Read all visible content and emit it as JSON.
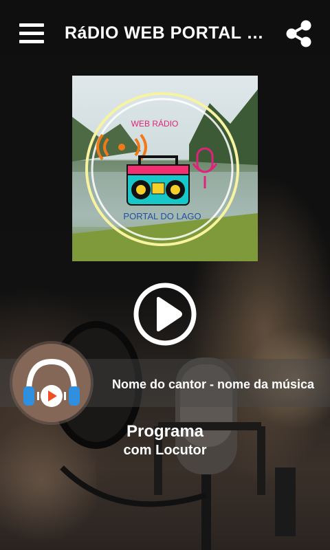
{
  "app": {
    "title": "RáDIO WEB PORTAL DO LAGO"
  },
  "icons": {
    "menu": "menu-icon",
    "share": "share-icon",
    "play": "play-icon",
    "headphones": "headphones-icon"
  },
  "album_art": {
    "line1": "WEB RÁDIO",
    "line2": "PORTAL DO LAGO"
  },
  "now_playing": {
    "track": "Nome do cantor - nome da música"
  },
  "program": {
    "name": "Programa",
    "host": "com Locutor"
  },
  "colors": {
    "background": "#0d0d0d",
    "text": "#ffffff",
    "avatar_bg": "#846756",
    "headphone_blue": "#2f8fe0",
    "play_orange": "#f04e23"
  }
}
